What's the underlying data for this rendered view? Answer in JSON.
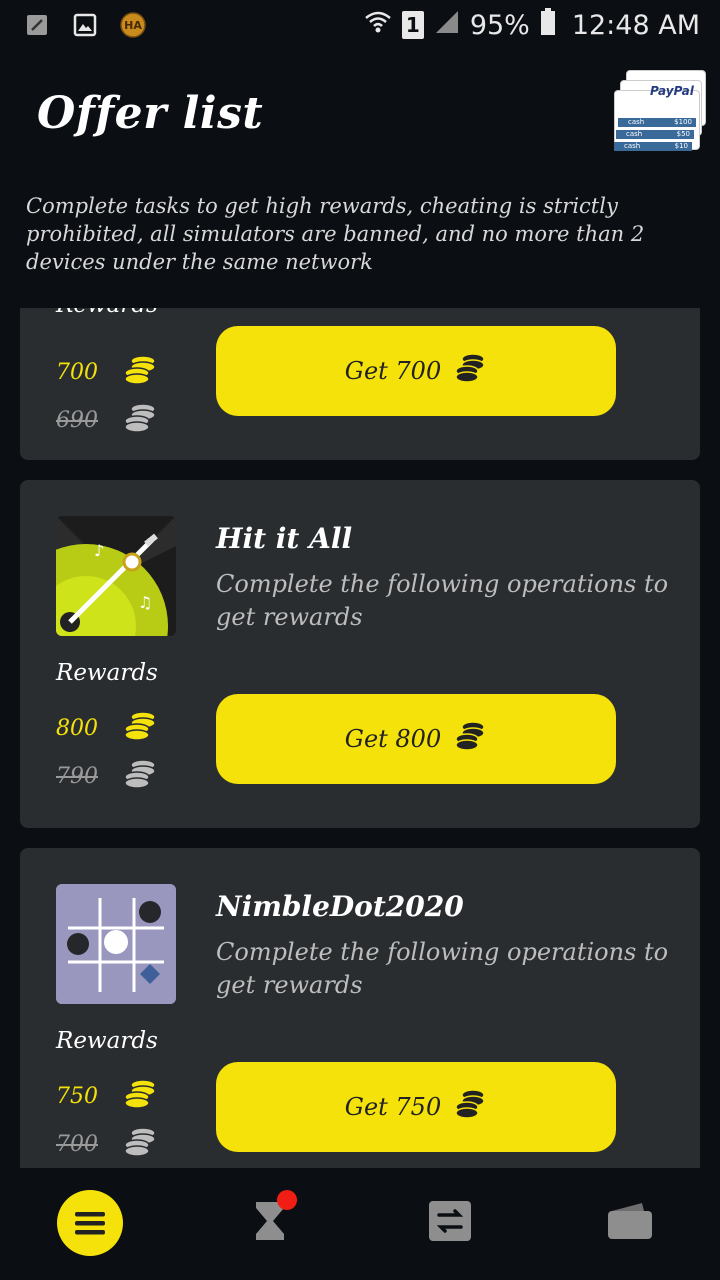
{
  "status_bar": {
    "icons_left": [
      "brush-icon",
      "image-icon",
      "ha-app-icon"
    ],
    "sim_number": "1",
    "battery_percent": "95%",
    "time": "12:48 AM"
  },
  "header": {
    "title": "Offer list",
    "paypal_label": "PayPal",
    "cash_labels": [
      "cash",
      "cash",
      "cash"
    ],
    "cash_amounts": [
      "$100",
      "$50",
      "$10"
    ],
    "subtitle": "Complete tasks to get high rewards, cheating is strictly prohibited, all simulators are banned, and no more than 2 devices under the same network"
  },
  "offers": [
    {
      "title": "",
      "description": "",
      "rewards_label": "Rewards",
      "reward_new": "700",
      "reward_old": "690",
      "button_label": "Get 700"
    },
    {
      "title": "Hit it All",
      "description": "Complete the following operations to get rewards",
      "rewards_label": "Rewards",
      "reward_new": "800",
      "reward_old": "790",
      "button_label": "Get 800"
    },
    {
      "title": "NimbleDot2020",
      "description": "Complete the following operations to get rewards",
      "rewards_label": "Rewards",
      "reward_new": "750",
      "reward_old": "700",
      "button_label": "Get 750"
    }
  ],
  "bottom_nav": {
    "items": [
      "offers-menu-icon",
      "hourglass-icon",
      "exchange-icon",
      "wallet-icon"
    ],
    "active": "offers-menu-icon"
  },
  "colors": {
    "background": "#0b0e13",
    "card": "#2a2d30",
    "accent": "#f4e20a",
    "badge": "#f01e14"
  }
}
